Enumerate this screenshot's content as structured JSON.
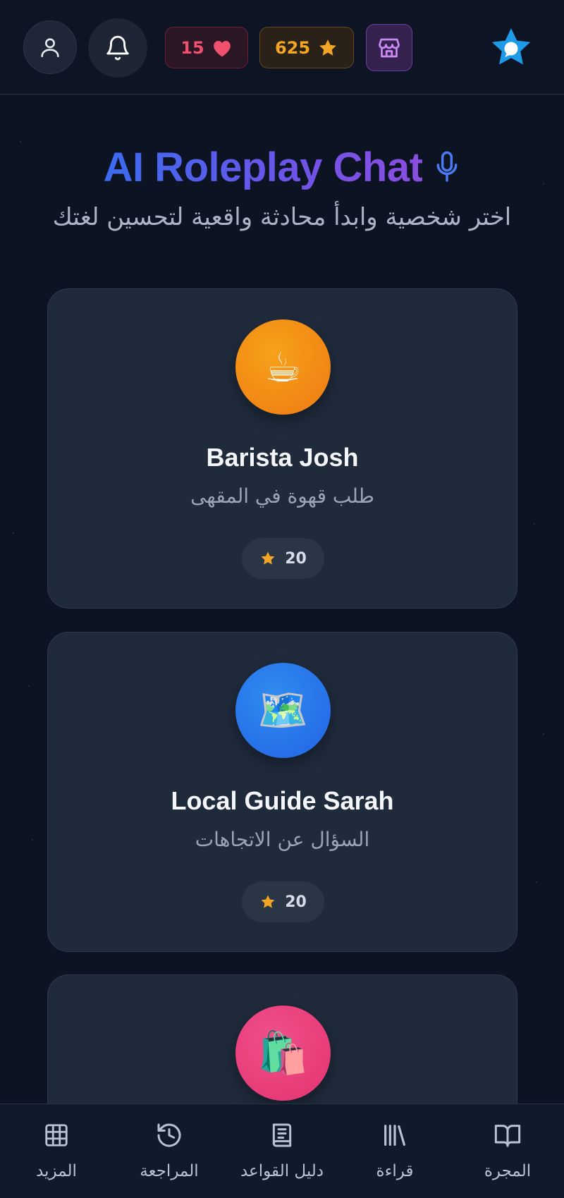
{
  "topbar": {
    "hearts_count": "15",
    "stars_count": "625",
    "icons": [
      "user-icon",
      "bell-icon",
      "heart-icon",
      "star-icon",
      "store-icon",
      "app-logo"
    ]
  },
  "header": {
    "title": "AI Roleplay Chat",
    "subtitle": "اختر شخصية وابدأ محادثة واقعية لتحسين لغتك"
  },
  "characters": [
    {
      "name": "Barista Josh",
      "description": "طلب قهوة في المقهى",
      "reward": "20",
      "emoji": "☕",
      "color": "#f28c16"
    },
    {
      "name": "Local Guide Sarah",
      "description": "السؤال عن الاتجاهات",
      "reward": "20",
      "emoji": "🗺️",
      "color": "#2a78ec"
    },
    {
      "name": "",
      "description": "",
      "reward": "",
      "emoji": "🛍️",
      "color": "#e8407b"
    }
  ],
  "bottom_nav": [
    {
      "label": "المزيد",
      "icon": "grid-icon"
    },
    {
      "label": "المراجعة",
      "icon": "history-icon"
    },
    {
      "label": "دليل القواعد",
      "icon": "book-text-icon"
    },
    {
      "label": "قراءة",
      "icon": "library-icon"
    },
    {
      "label": "المجرة",
      "icon": "open-book-icon"
    }
  ],
  "colors": {
    "background": "#0c1322",
    "card": "#1f2a3b",
    "heart": "#f0506e",
    "star": "#f5a524",
    "title_gradient_start": "#3a6bf0",
    "title_gradient_end": "#8a4ee0"
  }
}
